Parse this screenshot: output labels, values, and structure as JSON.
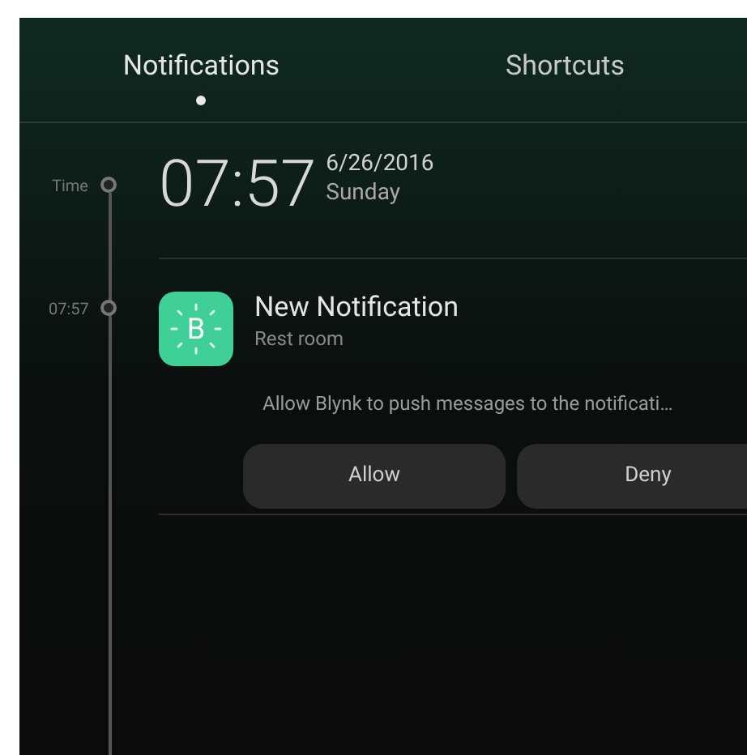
{
  "tabs": [
    {
      "label": "Notifications",
      "selected": true
    },
    {
      "label": "Shortcuts",
      "selected": false
    }
  ],
  "timeline": [
    {
      "label": "Time",
      "time": "07:57",
      "date": "6/26/2016",
      "weekday": "Sunday"
    }
  ],
  "notifications": [
    {
      "time_label": "07:57",
      "app_icon_letter": "B",
      "title": "New Notification",
      "subtitle": "Rest room",
      "message": "Allow Blynk to push messages to the notificati…",
      "buttons": [
        "Allow",
        "Deny"
      ]
    }
  ]
}
